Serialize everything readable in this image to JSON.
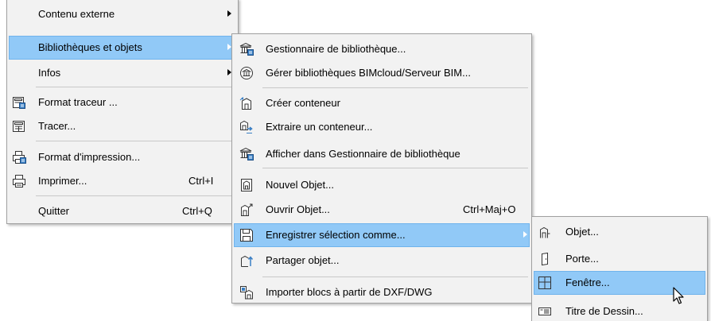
{
  "menu1": {
    "contenu_externe": "Contenu externe",
    "bibliotheques": "Bibliothèques et objets",
    "infos": "Infos",
    "format_traceur": "Format traceur ...",
    "tracer": "Tracer...",
    "format_impression": "Format d'impression...",
    "imprimer": "Imprimer...",
    "imprimer_shortcut": "Ctrl+I",
    "quitter": "Quitter",
    "quitter_shortcut": "Ctrl+Q"
  },
  "menu2": {
    "gestionnaire": "Gestionnaire de bibliothèque...",
    "gerer": "Gérer bibliothèques BIMcloud/Serveur BIM...",
    "creer_conteneur": "Créer conteneur",
    "extraire": "Extraire un conteneur...",
    "afficher": "Afficher dans Gestionnaire de bibliothèque",
    "nouvel_objet": "Nouvel Objet...",
    "ouvrir_objet": "Ouvrir Objet...",
    "ouvrir_shortcut": "Ctrl+Maj+O",
    "enregistrer": "Enregistrer sélection comme...",
    "partager": "Partager objet...",
    "importer": "Importer blocs à partir de DXF/DWG"
  },
  "menu3": {
    "objet": "Objet...",
    "porte": "Porte...",
    "fenetre": "Fenêtre...",
    "titre": "Titre de Dessin..."
  },
  "colors": {
    "menu_bg": "#f2f2f2",
    "highlight": "#91c9f7",
    "highlight_border": "#6fb3ec",
    "separator": "#c8c8c8"
  }
}
